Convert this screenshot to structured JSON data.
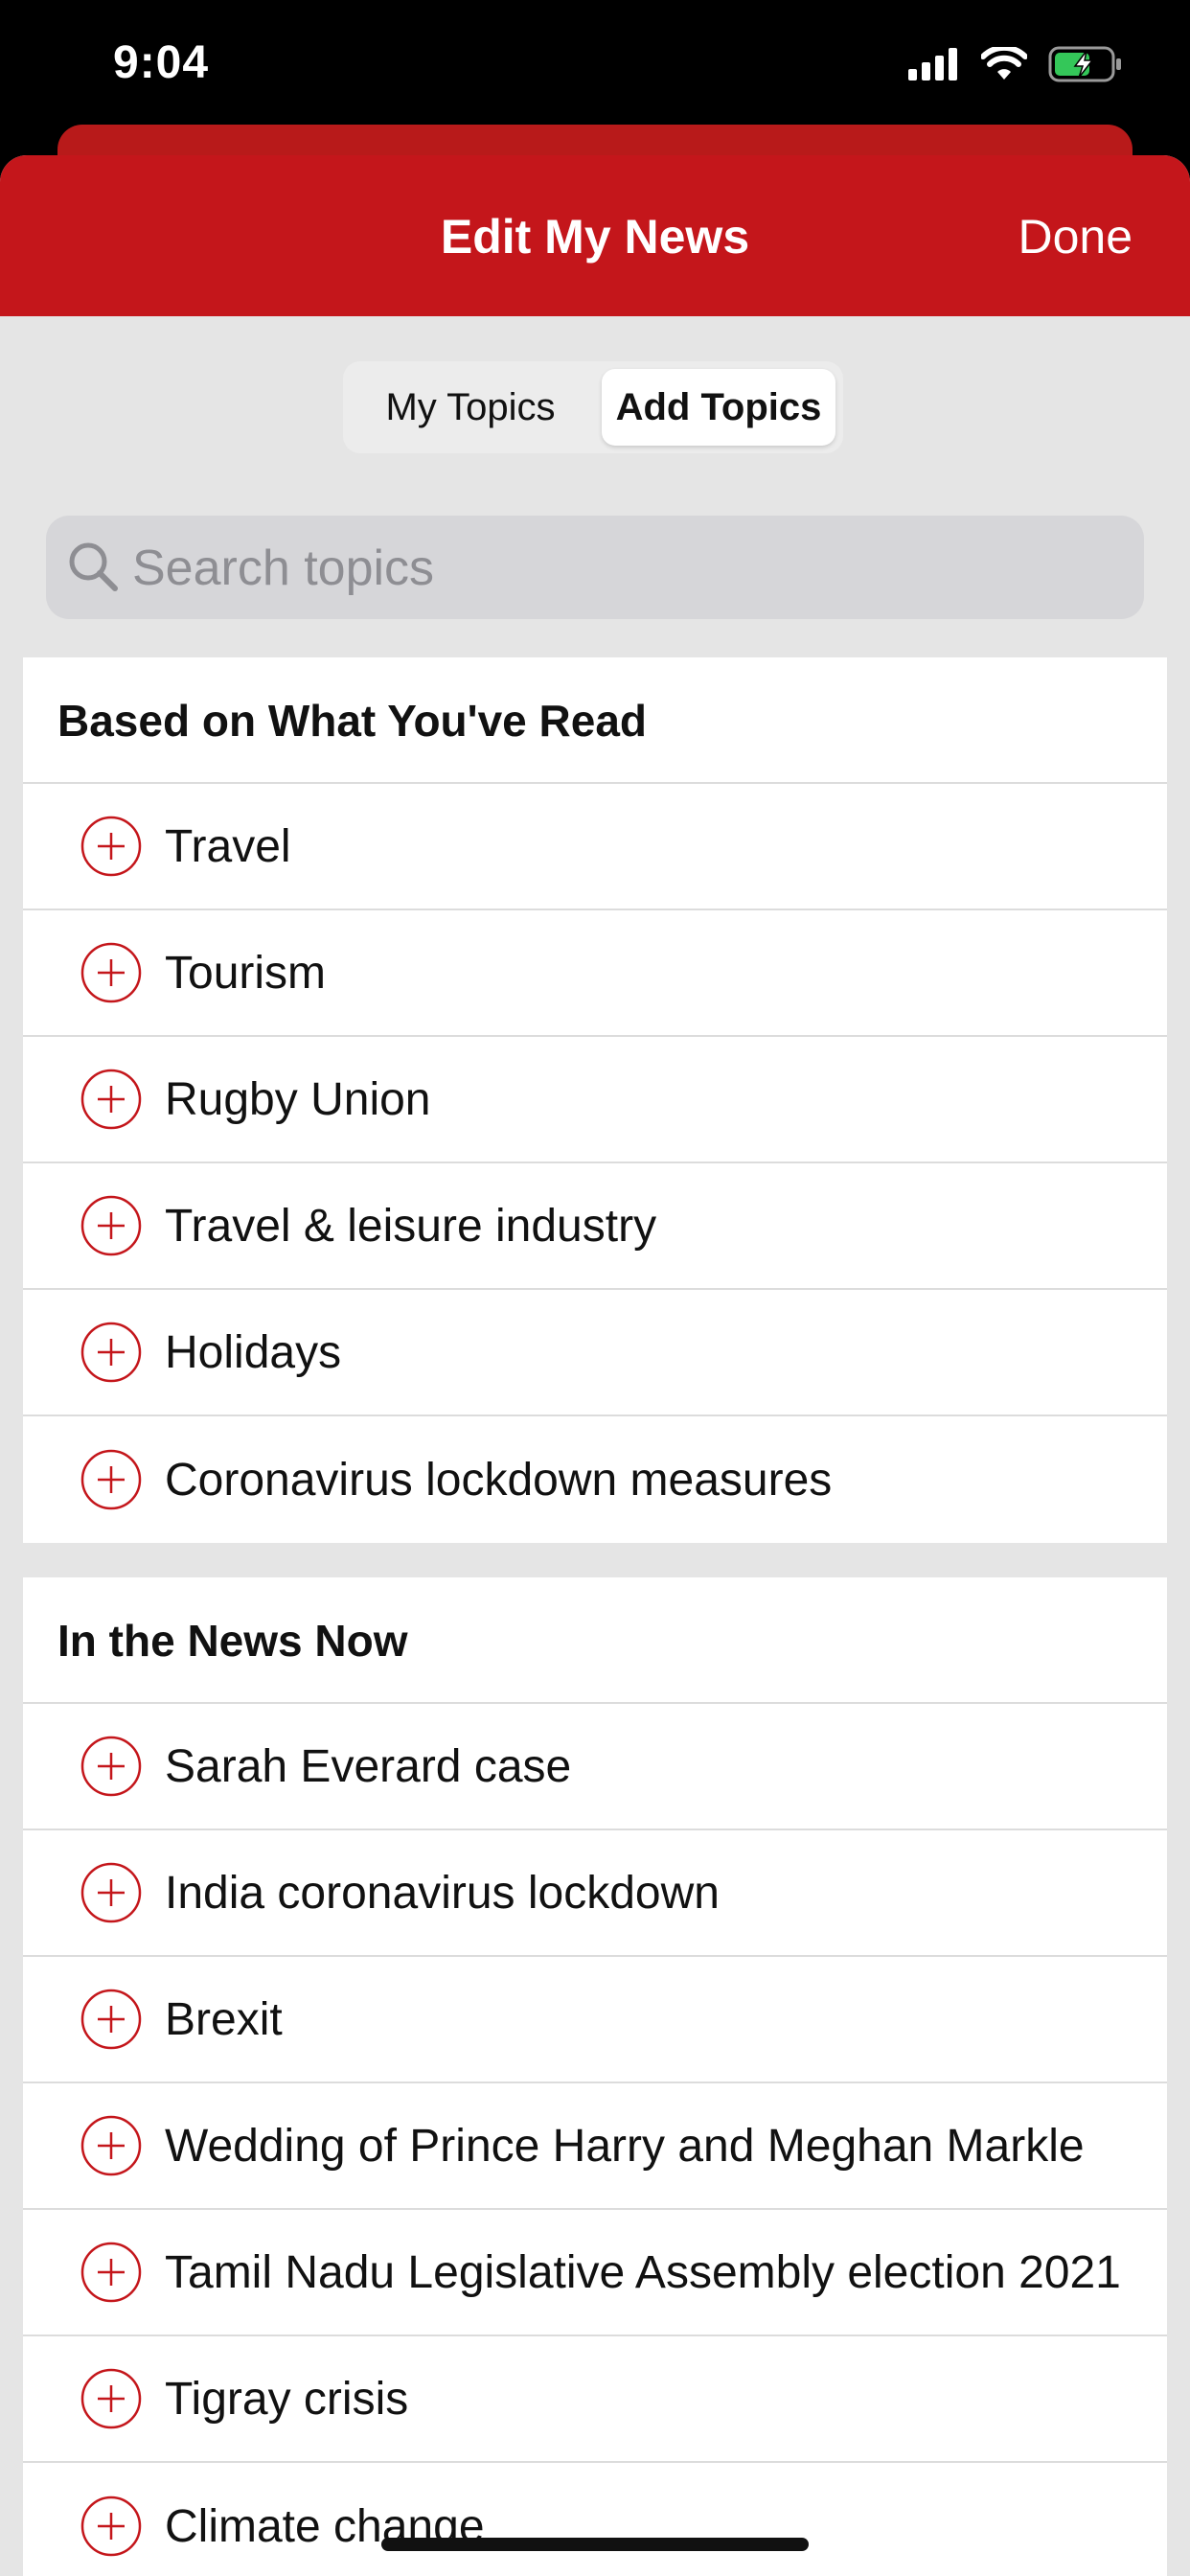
{
  "status_bar": {
    "time": "9:04"
  },
  "header": {
    "title": "Edit My News",
    "done_label": "Done"
  },
  "segments": {
    "my_topics": "My Topics",
    "add_topics": "Add Topics",
    "selected": "Add Topics"
  },
  "search": {
    "placeholder": "Search topics"
  },
  "sections": [
    {
      "title": "Based on What You've Read",
      "items": [
        "Travel",
        "Tourism",
        "Rugby Union",
        "Travel & leisure industry",
        "Holidays",
        "Coronavirus lockdown measures"
      ]
    },
    {
      "title": "In the News Now",
      "items": [
        "Sarah Everard case",
        "India coronavirus lockdown",
        "Brexit",
        "Wedding of Prince Harry and Meghan Markle",
        "Tamil Nadu Legislative Assembly election 2021",
        "Tigray crisis",
        "Climate change"
      ]
    }
  ],
  "colors": {
    "accent": "#c4161b",
    "background": "#e5e5e5"
  }
}
